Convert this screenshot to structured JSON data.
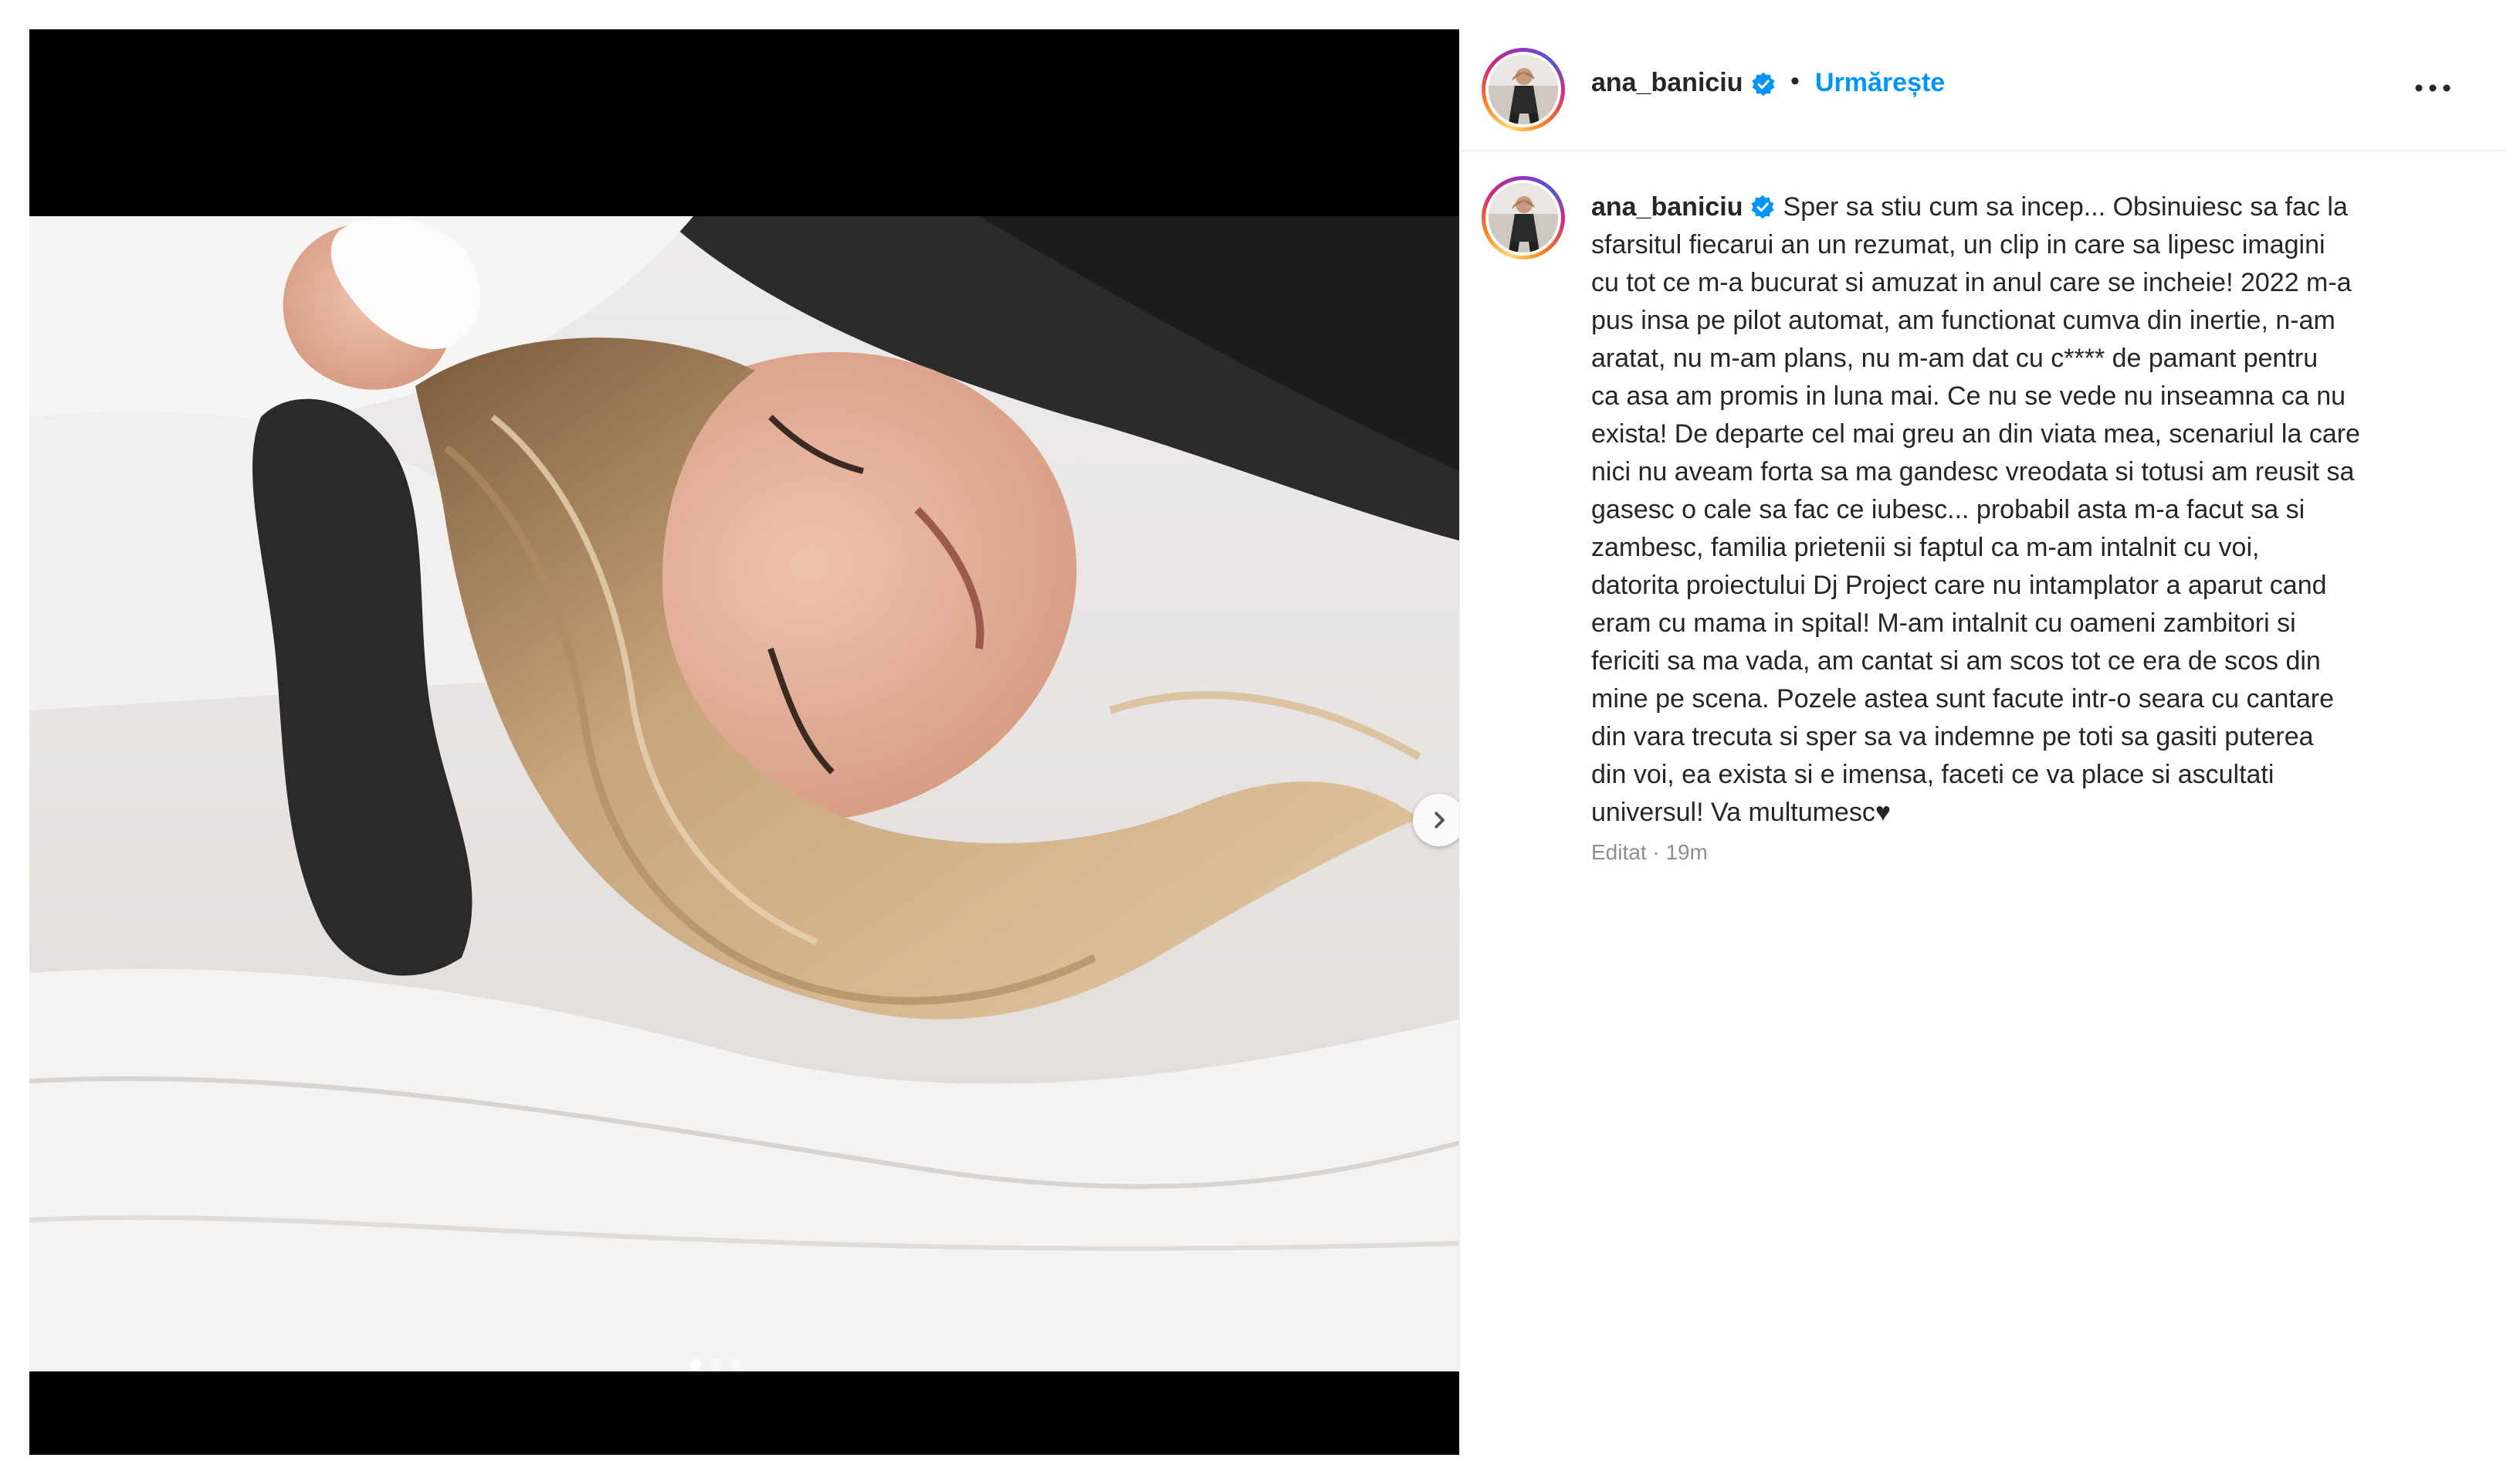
{
  "post": {
    "username": "ana_baniciu",
    "separator": "•",
    "follow_label": "Urmărește",
    "more_label": "Mai multe opțiuni",
    "caption_lines": [
      "Sper sa stiu cum sa incep... Obsinuiesc sa fac la",
      "sfarsitul fiecarui an un rezumat, un clip in care sa lipesc imagini",
      "cu tot ce m-a bucurat si amuzat in anul care se incheie! 2022 m-a",
      "pus insa pe pilot automat, am functionat cumva din inertie, n-am",
      "aratat, nu m-am plans, nu m-am dat cu c**** de pamant pentru",
      "ca asa am promis in luna mai. Ce nu se vede nu inseamna ca nu",
      "exista! De departe cel mai greu an din viata mea, scenariul la care",
      "nici nu aveam forta sa ma gandesc vreodata si totusi am reusit sa",
      "gasesc o cale sa fac ce iubesc... probabil asta m-a facut sa si",
      "zambesc, familia prietenii si faptul ca m-am intalnit cu voi,",
      "datorita proiectului Dj Project care nu intamplator a aparut cand",
      "eram cu mama in spital! M-am intalnit cu oameni zambitori si",
      "fericiti sa ma vada, am cantat si am scos tot ce era de scos din",
      "mine pe scena. Pozele astea sunt facute intr-o seara cu cantare",
      "din vara trecuta si sper sa va indemne pe toti sa gasiti puterea",
      "din voi, ea exista si e imensa, faceti ce va place si ascultati",
      "universul! Va multumesc♥"
    ],
    "edited_label": "Editat · 19m"
  },
  "carousel": {
    "slide_count": 3,
    "active_index": 0
  },
  "icons": {
    "verified": "verified-badge-icon",
    "more": "more-options-icon",
    "next": "chevron-right-icon"
  },
  "colors": {
    "accent": "#0095f6",
    "verified": "#0095f6",
    "text": "#262626",
    "muted": "#8e8e8e"
  }
}
